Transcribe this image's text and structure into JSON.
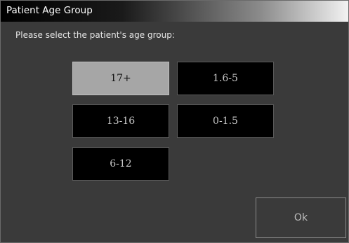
{
  "window": {
    "title": "Patient Age Group"
  },
  "prompt": "Please select the patient's age group:",
  "age_groups": [
    {
      "label": "17+",
      "selected": true
    },
    {
      "label": "1.6-5",
      "selected": false
    },
    {
      "label": "13-16",
      "selected": false
    },
    {
      "label": "0-1.5",
      "selected": false
    },
    {
      "label": "6-12",
      "selected": false
    }
  ],
  "ok_label": "Ok",
  "colors": {
    "window_bg": "#3a3a3a",
    "button_bg": "#000000",
    "selected_bg": "#a6a6a6"
  }
}
